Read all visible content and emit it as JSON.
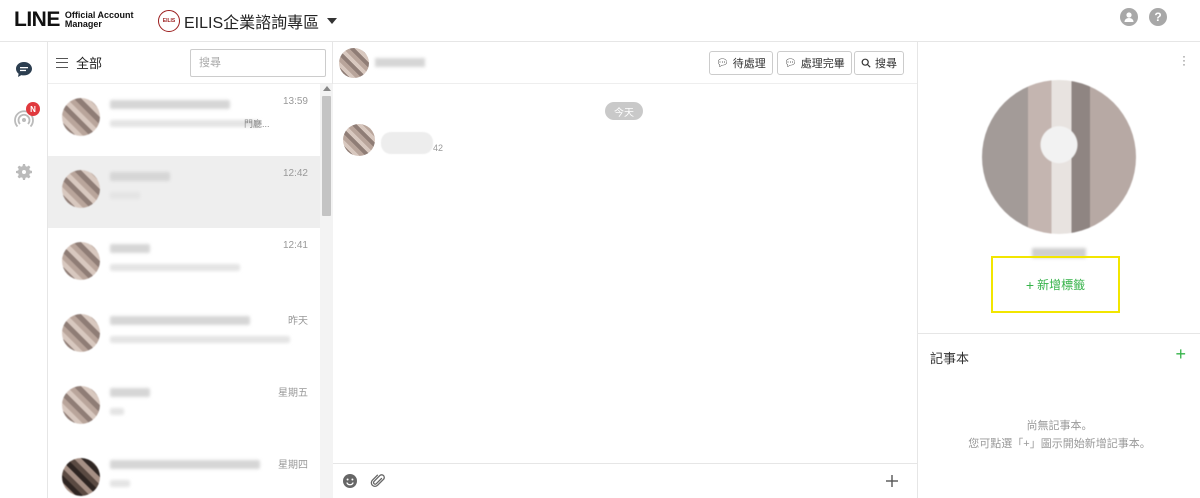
{
  "topbar": {
    "logo_main": "LINE",
    "logo_sub_1": "Official Account",
    "logo_sub_2": "Manager",
    "account_avatar_text": "EILIS",
    "account_name": "EILIS企業諮詢專區",
    "icons": [
      "user-icon",
      "help-icon"
    ],
    "help_label": "?"
  },
  "sidenav": {
    "items": [
      {
        "name": "chat",
        "icon": "chat-bubble-icon",
        "active": true
      },
      {
        "name": "broadcast",
        "icon": "broadcast-icon",
        "badge": "N"
      },
      {
        "name": "settings",
        "icon": "gear-icon"
      }
    ],
    "accent_color": "#2c3e50"
  },
  "chat_list": {
    "filter_label": "全部",
    "search_placeholder": "搜尋",
    "rows": [
      {
        "time": "13:59",
        "msg_tail": "門廳...",
        "active": false
      },
      {
        "time": "12:42",
        "msg_tail": "",
        "active": true
      },
      {
        "time": "12:41",
        "msg_tail": "",
        "active": false
      },
      {
        "time": "昨天",
        "msg_tail": "",
        "active": false
      },
      {
        "time": "星期五",
        "msg_tail": "",
        "active": false
      },
      {
        "time": "星期四",
        "msg_tail": "",
        "active": false
      }
    ]
  },
  "chat": {
    "buttons": {
      "pending": "待處理",
      "done": "處理完畢",
      "search": "搜尋"
    },
    "date_chip": "今天",
    "message_time": "42"
  },
  "profile": {
    "add_tag_label": "新增標籤",
    "notes_title": "記事本",
    "notes_empty_line1": "尚無記事本。",
    "notes_empty_line2": "您可點選「+」圖示開始新增記事本。",
    "highlight_color": "#f2e600",
    "accent_green": "#36b34a"
  }
}
